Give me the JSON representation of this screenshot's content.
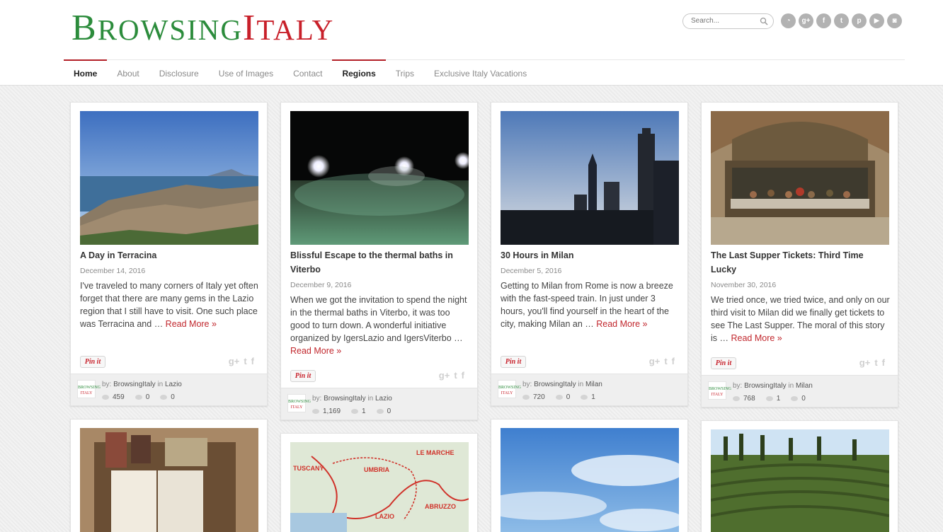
{
  "site": {
    "logo_text": "BROWSINGITALY",
    "search_placeholder": "Search...",
    "social_icons": [
      "rss-icon",
      "google-plus-icon",
      "facebook-icon",
      "twitter-icon",
      "pinterest-icon",
      "youtube-icon",
      "instagram-icon"
    ]
  },
  "nav": [
    {
      "label": "Home",
      "active": true
    },
    {
      "label": "About",
      "active": false
    },
    {
      "label": "Disclosure",
      "active": false
    },
    {
      "label": "Use of Images",
      "active": false
    },
    {
      "label": "Contact",
      "active": false
    },
    {
      "label": "Regions",
      "active": true
    },
    {
      "label": "Trips",
      "active": false
    },
    {
      "label": "Exclusive Italy Vacations",
      "active": false
    }
  ],
  "colors": {
    "brand_green": "#2c8c3c",
    "brand_red": "#c8202a",
    "link_red": "#c1272d"
  },
  "posts": [
    {
      "title": "A Day in Terracina",
      "date": "December 14, 2016",
      "excerpt": "I've traveled to many corners of Italy yet often forget that there are many gems in the Lazio region that I still have to visit. One such place was Terracina and … ",
      "read_more": "Read More »",
      "pin_label": "Pin it",
      "by_label": "by:",
      "author": "BrowsingItaly",
      "in_label": "in",
      "category": "Lazio",
      "views": "459",
      "comments": "0",
      "likes": "0"
    },
    {
      "title": "Blissful Escape to the thermal baths in Viterbo",
      "date": "December 9, 2016",
      "excerpt": "When we got the invitation to spend the night in the thermal baths in Viterbo, it was too good to turn down. A wonderful initiative organized by IgersLazio and IgersViterbo … ",
      "read_more": "Read More »",
      "pin_label": "Pin it",
      "by_label": "by:",
      "author": "BrowsingItaly",
      "in_label": "in",
      "category": "Lazio",
      "views": "1,169",
      "comments": "1",
      "likes": "0"
    },
    {
      "title": "30 Hours in Milan",
      "date": "December 5, 2016",
      "excerpt": "Getting to Milan from Rome is now a breeze with the fast-speed train. In just under 3 hours, you'll find yourself in the heart of the city, making Milan an … ",
      "read_more": "Read More »",
      "pin_label": "Pin it",
      "by_label": "by:",
      "author": "BrowsingItaly",
      "in_label": "in",
      "category": "Milan",
      "views": "720",
      "comments": "0",
      "likes": "1"
    },
    {
      "title": "The Last Supper Tickets: Third Time Lucky",
      "date": "November 30, 2016",
      "excerpt": "We tried once, we tried twice, and only on our third visit to Milan did we finally get tickets to see The Last Supper. The moral of this story is … ",
      "read_more": "Read More »",
      "pin_label": "Pin it",
      "by_label": "by:",
      "author": "BrowsingItaly",
      "in_label": "in",
      "category": "Milan",
      "views": "768",
      "comments": "1",
      "likes": "0"
    }
  ],
  "footer_logo": {
    "line1": "BROWSING",
    "line2": "ITALY"
  },
  "map_labels": [
    "LE MARCHE",
    "TUSCANY",
    "UMBRIA",
    "ABRUZZO",
    "LAZIO"
  ]
}
